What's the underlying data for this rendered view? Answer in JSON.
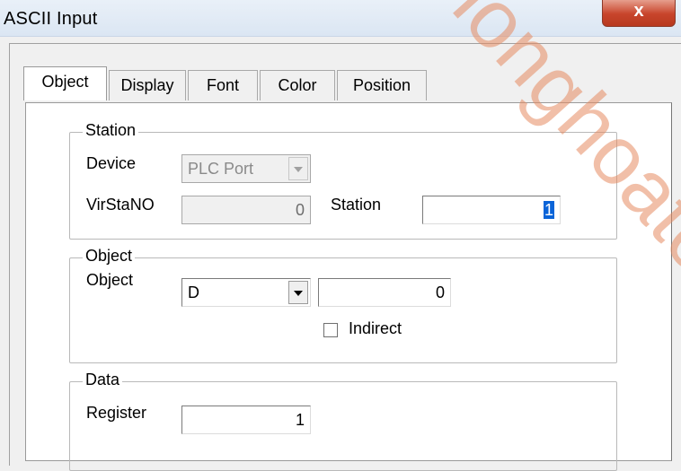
{
  "window": {
    "title": "ASCII Input",
    "close_glyph": "x"
  },
  "tabs": [
    {
      "label": "Object",
      "active": true
    },
    {
      "label": "Display",
      "active": false
    },
    {
      "label": "Font",
      "active": false
    },
    {
      "label": "Color",
      "active": false
    },
    {
      "label": "Position",
      "active": false
    }
  ],
  "station": {
    "title": "Station",
    "device_label": "Device",
    "device_value": "PLC Port",
    "virsta_label": "VirStaNO",
    "virsta_value": "0",
    "station_label": "Station",
    "station_value": "1"
  },
  "object": {
    "title": "Object",
    "object_label": "Object",
    "object_type": "D",
    "object_address": "0",
    "indirect_label": "Indirect",
    "indirect_checked": false
  },
  "data": {
    "title": "Data",
    "register_label": "Register",
    "register_value": "1"
  },
  "watermark": {
    "text": "ionghoato",
    "color": "#e58a60"
  }
}
